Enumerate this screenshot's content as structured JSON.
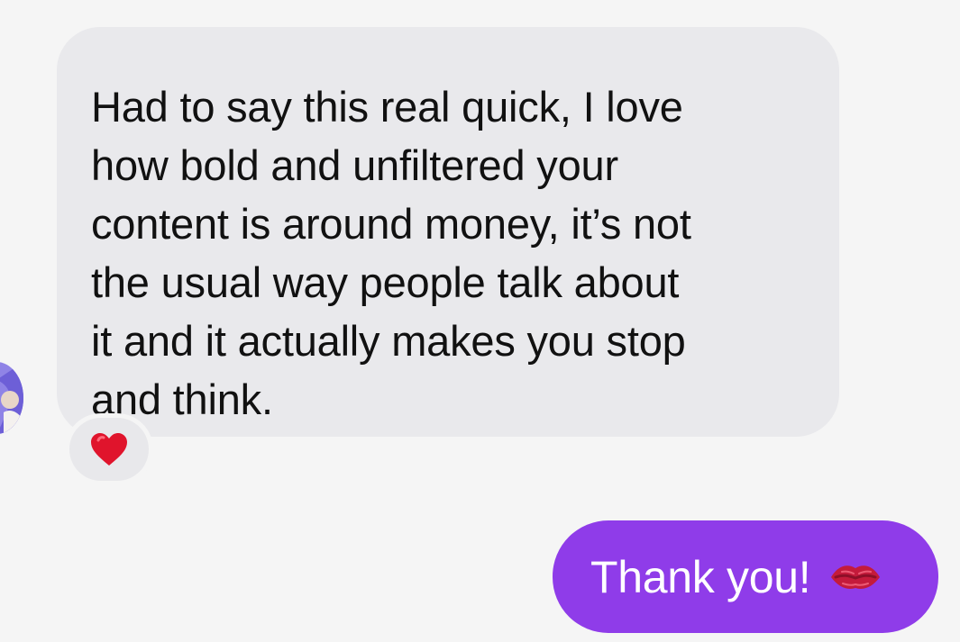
{
  "conversation": {
    "incoming_message": {
      "text": "Had to say this real quick, I love\nhow bold and unfiltered your\ncontent is around money, it’s not\nthe usual way people talk about\nit and it actually makes you stop\nand think.",
      "reaction": "❤️"
    },
    "outgoing_message": {
      "text": "Thank you!",
      "emoji": "💋"
    }
  },
  "colors": {
    "background": "#f5f5f5",
    "incoming_bubble": "#e9e9ec",
    "outgoing_bubble": "#8f3ce9",
    "outgoing_text": "#ffffff",
    "heart": "#e0142c",
    "lips": "#c41b3b"
  },
  "icons": {
    "avatar": "avatar",
    "reaction": "heart-icon",
    "emoji": "kiss-mark-icon"
  }
}
